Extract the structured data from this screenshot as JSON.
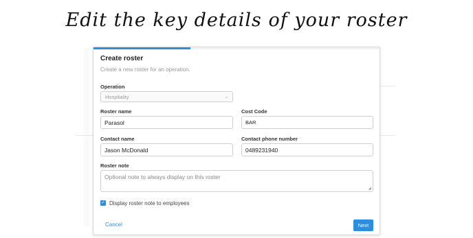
{
  "headline": "Edit the key details of your roster",
  "dialog": {
    "title": "Create roster",
    "subtitle": "Create a new roster for an operation.",
    "progress_fraction": 0.34
  },
  "form": {
    "operation": {
      "label": "Operation",
      "value": "Hospitality"
    },
    "roster_name": {
      "label": "Roster name",
      "value": "Parasol"
    },
    "cost_code": {
      "label": "Cost Code",
      "value": "BAR"
    },
    "contact_name": {
      "label": "Contact name",
      "value": "Jason McDonald"
    },
    "contact_phone": {
      "label": "Contact phone number",
      "value": "0489231940"
    },
    "roster_note": {
      "label": "Roster note",
      "placeholder": "Optional note to always display on this roster"
    },
    "display_note": {
      "label": "Display roster note to employees",
      "checked": true
    }
  },
  "actions": {
    "cancel": "Cancel",
    "next": "Next"
  },
  "colors": {
    "accent": "#2d8ee0"
  },
  "icons": {
    "select_chevron": "chevron-down-icon",
    "checkbox": "check-icon",
    "resize": "resize-handle-icon"
  }
}
